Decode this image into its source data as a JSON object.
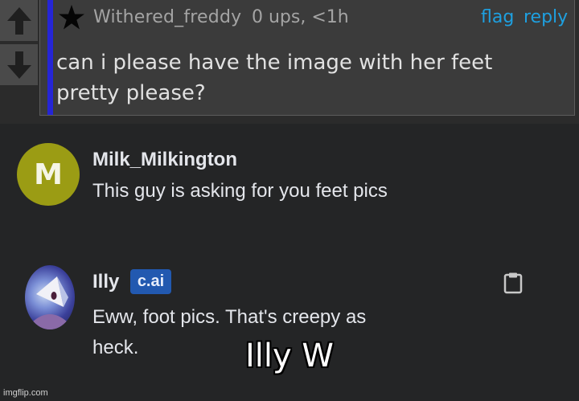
{
  "forum_comment": {
    "username": "Withered_freddy",
    "meta": "0 ups, <1h",
    "flag_label": "flag",
    "reply_label": "reply",
    "text": "can i please have the image with her feet pretty please?",
    "accent_color": "#2525d6",
    "link_color": "#1ea0e0"
  },
  "chat": {
    "messages": [
      {
        "avatar_letter": "M",
        "avatar_color": "#9b9c14",
        "name": "Milk_Milkington",
        "text": "This guy is asking for you feet pics"
      },
      {
        "name": "Illy",
        "badge": "c.ai",
        "badge_color": "#2259b0",
        "text": "Eww, foot pics. That's creepy as heck."
      }
    ]
  },
  "caption": "Illy W",
  "watermark": "imgflip.com",
  "icons": [
    "upvote-arrow-icon",
    "downvote-arrow-icon",
    "star-icon",
    "clipboard-icon"
  ]
}
